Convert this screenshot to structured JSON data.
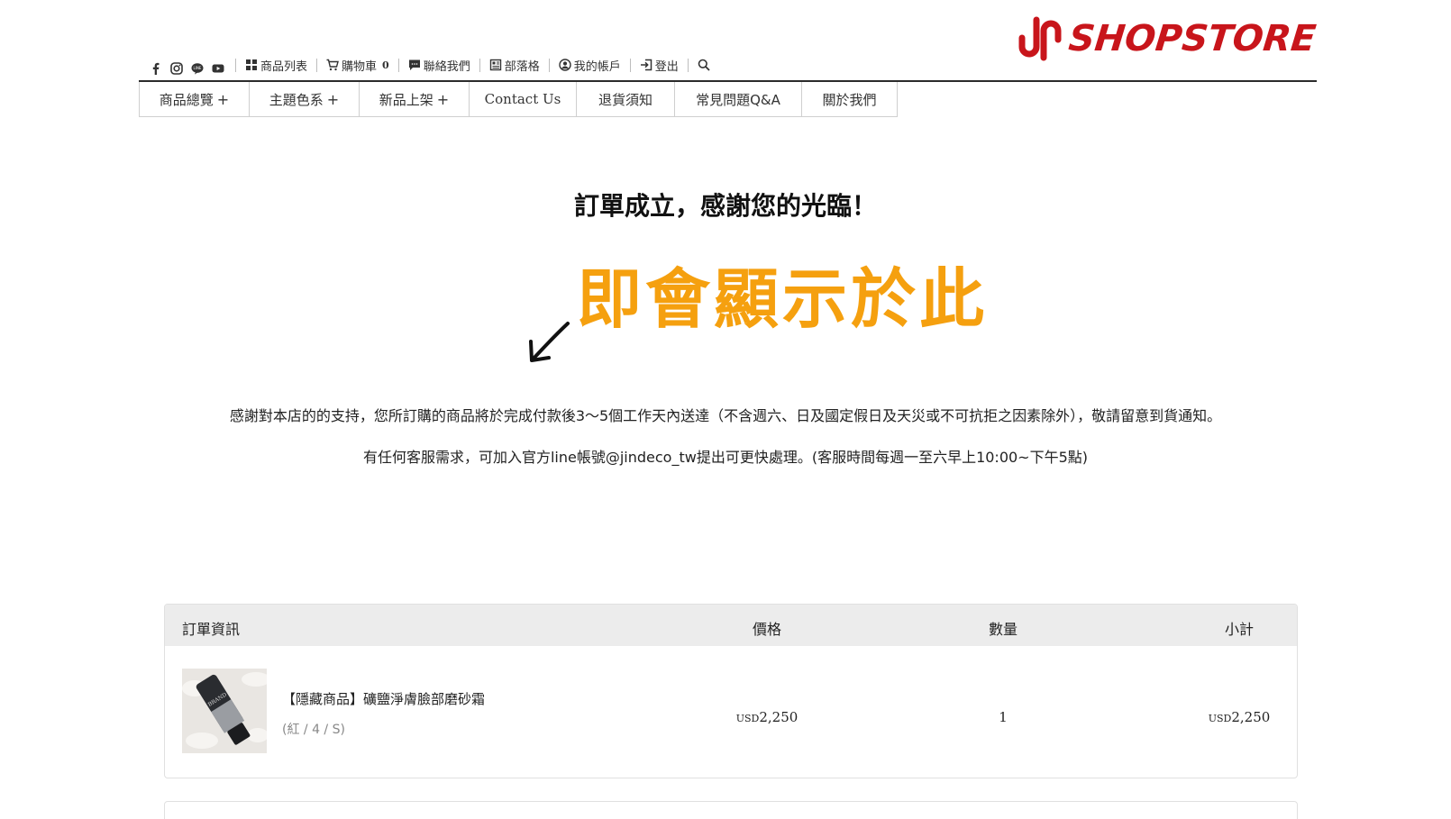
{
  "brand": {
    "name": "SHOPSTORE",
    "color": "#c8151b"
  },
  "topbar": {
    "social": [
      "facebook-icon",
      "instagram-icon",
      "line-icon",
      "youtube-icon"
    ],
    "links": [
      {
        "label": "商品列表",
        "icon": "grid-icon"
      },
      {
        "label": "購物車",
        "icon": "cart-icon",
        "count": "0"
      },
      {
        "label": "聯絡我們",
        "icon": "chat-icon"
      },
      {
        "label": "部落格",
        "icon": "blog-icon"
      },
      {
        "label": "我的帳戶",
        "icon": "account-icon"
      },
      {
        "label": "登出",
        "icon": "logout-icon"
      }
    ],
    "search_icon": "search-icon"
  },
  "nav": {
    "items": [
      {
        "label": "商品總覽",
        "plus": "+"
      },
      {
        "label": "主題色系",
        "plus": "+"
      },
      {
        "label": "新品上架",
        "plus": "+"
      },
      {
        "label": "Contact Us"
      },
      {
        "label": "退貨須知"
      },
      {
        "label": "常見問題Q&A"
      },
      {
        "label": "關於我們"
      }
    ]
  },
  "main": {
    "title": "訂單成立，感謝您的光臨！",
    "annotation": "即會顯示於此",
    "annotation_color": "#f5a00f",
    "message_1": "感謝對本店的的支持，您所訂購的商品將於完成付款後3～5個工作天內送達（不含週六、日及國定假日及天災或不可抗拒之因素除外），敬請留意到貨通知。",
    "message_2": "有任何客服需求，可加入官方line帳號@jindeco_tw提出可更快處理。(客服時間每週一至六早上10:00~下午5點)"
  },
  "order": {
    "headers": {
      "info": "訂單資訊",
      "price": "價格",
      "qty": "數量",
      "subtotal": "小計"
    },
    "items": [
      {
        "name": "【隱藏商品】礦鹽淨膚臉部磨砂霜",
        "variant": "(紅 / 4 / S)",
        "currency": "USD",
        "price": "2,250",
        "qty": "1",
        "subtotal": "2,250",
        "thumb_label": "BRAND"
      }
    ]
  }
}
